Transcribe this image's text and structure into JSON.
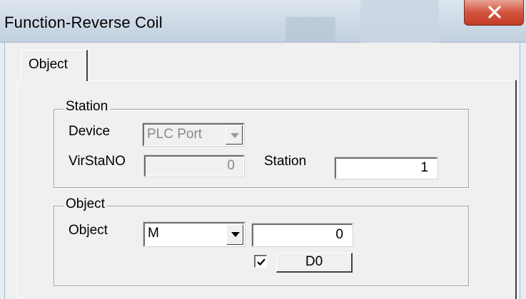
{
  "window": {
    "title": "Function-Reverse Coil",
    "close_glyph": "X"
  },
  "tabs": [
    {
      "label": "Object",
      "active": true
    }
  ],
  "station_group": {
    "legend": "Station",
    "device_label": "Device",
    "device_value": "PLC Port",
    "virstano_label": "VirStaNO",
    "virstano_value": "0",
    "station_label": "Station",
    "station_value": "1"
  },
  "object_group": {
    "legend": "Object",
    "object_label": "Object",
    "object_type_value": "M",
    "object_address_value": "0",
    "checkbox_checked": true,
    "button_label": "D0"
  },
  "colors": {
    "dialog_bg": "#f0f0f0",
    "close_button": "#c94a35",
    "disabled_text": "#8a8a8a"
  }
}
